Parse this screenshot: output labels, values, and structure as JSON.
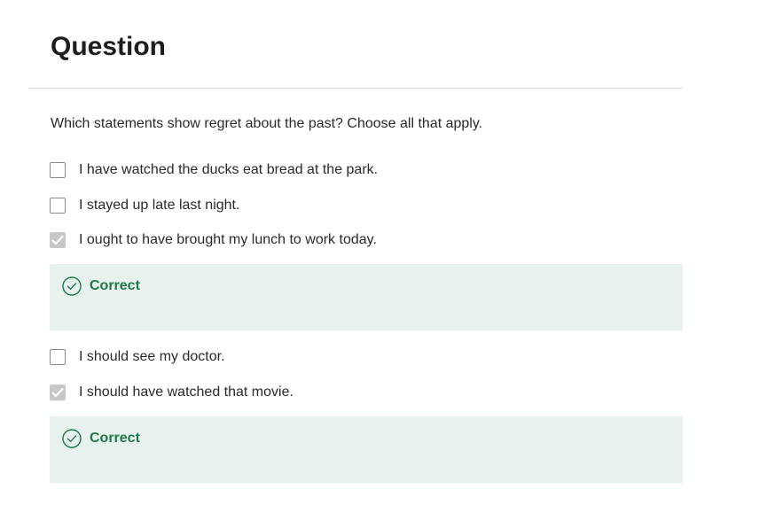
{
  "question": {
    "title": "Question",
    "prompt": "Which statements show regret about the past? Choose all that apply."
  },
  "options": [
    {
      "label": "I have watched the ducks eat bread at the park.",
      "checked": false
    },
    {
      "label": "I stayed up late last night.",
      "checked": false
    },
    {
      "label": "I ought to have brought my lunch to work today.",
      "checked": true,
      "feedback": "Correct"
    },
    {
      "label": "I should see my doctor.",
      "checked": false
    },
    {
      "label": "I should have watched that movie.",
      "checked": true,
      "feedback": "Correct"
    }
  ],
  "colors": {
    "feedback_background": "#e7f1ed",
    "feedback_text": "#1f7a4a",
    "checked_checkbox": "#c7c7c7"
  },
  "icons": {
    "checked": "checkmark-icon",
    "feedback": "check-circle-icon"
  }
}
